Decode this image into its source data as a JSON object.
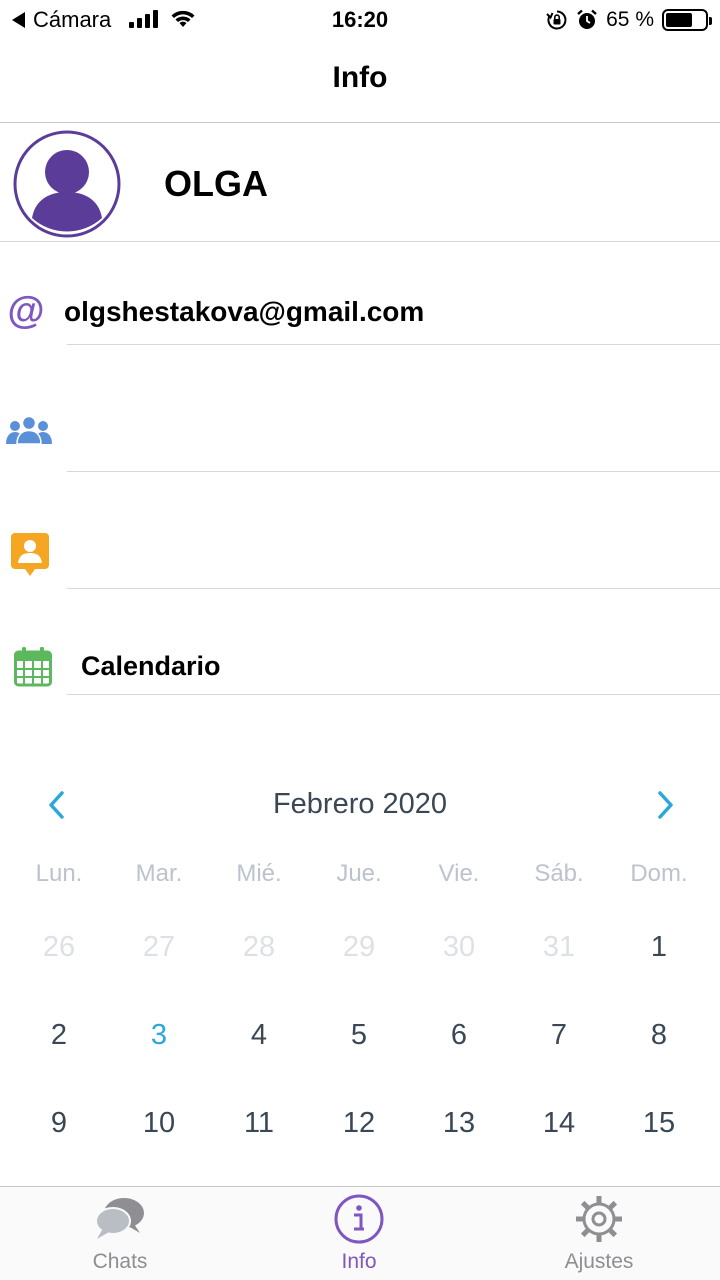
{
  "status_bar": {
    "back_label": "Cámara",
    "time": "16:20",
    "battery": "65 %",
    "battery_level": 0.65
  },
  "nav": {
    "title": "Info"
  },
  "profile": {
    "name": "OLGA"
  },
  "rows": {
    "email": {
      "icon": "at-icon",
      "value": "olgshestakova@gmail.com"
    },
    "group": {
      "icon": "group-icon",
      "value": ""
    },
    "contact": {
      "icon": "contact-card-icon",
      "value": ""
    },
    "calendar": {
      "icon": "calendar-icon",
      "value": "Calendario"
    }
  },
  "calendar": {
    "month": "Febrero 2020",
    "weekdays": [
      "Lun.",
      "Mar.",
      "Mié.",
      "Jue.",
      "Vie.",
      "Sáb.",
      "Dom."
    ],
    "weeks": [
      [
        "26",
        "27",
        "28",
        "29",
        "30",
        "31",
        "1"
      ],
      [
        "2",
        "3",
        "4",
        "5",
        "6",
        "7",
        "8"
      ],
      [
        "9",
        "10",
        "11",
        "12",
        "13",
        "14",
        "15"
      ]
    ],
    "today_color": "#2aa8dc"
  },
  "tabbar": {
    "tabs": [
      {
        "label": "Chats",
        "icon": "chat-bubbles-icon"
      },
      {
        "label": "Info",
        "icon": "info-icon"
      },
      {
        "label": "Ajustes",
        "icon": "gear-icon"
      }
    ],
    "active_index": 1,
    "active_color": "#7e57c2",
    "inactive_color": "#8e8e93"
  },
  "colors": {
    "accent_purple": "#7e57c2",
    "avatar_purple": "#5b3d99",
    "group_blue": "#5b8fd8",
    "contact_orange": "#f5a623",
    "calendar_green": "#5cb85c"
  }
}
